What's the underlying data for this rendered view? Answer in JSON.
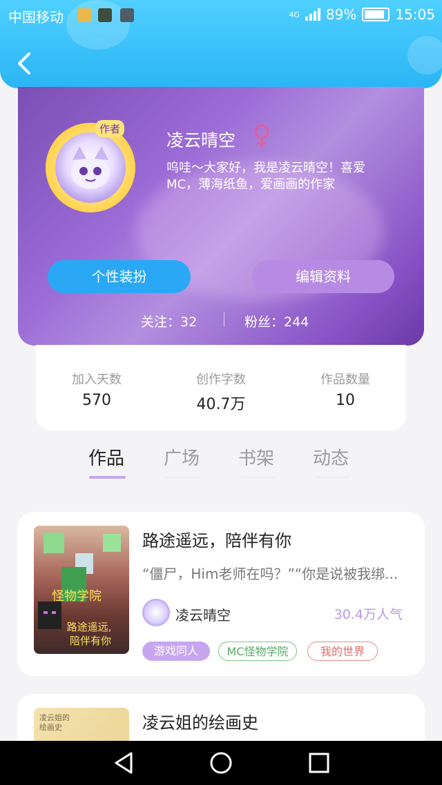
{
  "status": {
    "carrier": "中国移动",
    "network": "4G",
    "battery": "89%",
    "time": "15:05"
  },
  "profile": {
    "author_badge": "作者",
    "name": "凌云晴空",
    "bio": "呜哇～大家好，我是凌云晴空！喜爱MC，薄海纸鱼，爱画画的作家",
    "button_outfit": "个性装扮",
    "button_edit": "编辑资料",
    "following": "关注：32",
    "followers": "粉丝：244"
  },
  "stats": [
    {
      "label": "加入天数",
      "value": "570"
    },
    {
      "label": "创作字数",
      "value": "40.7万"
    },
    {
      "label": "作品数量",
      "value": "10"
    }
  ],
  "tabs": [
    "作品",
    "广场",
    "书架",
    "动态"
  ],
  "works": [
    {
      "title": "路途遥远，陪伴有你",
      "excerpt": "“僵尸，Him老师在吗？”“你是说被我绑...",
      "author": "凌云晴空",
      "popularity": "30.4万人气",
      "tags": [
        "游戏同人",
        "MC怪物学院",
        "我的世界"
      ],
      "cover_text": "怪物学院 路途遥远,陪伴有你"
    },
    {
      "title": "凌云姐的绘画史",
      "cover_text": "凌云姐的绘画史"
    }
  ],
  "colors": {
    "accent_blue": "#2aa8f5",
    "accent_purple": "#b78be3"
  }
}
